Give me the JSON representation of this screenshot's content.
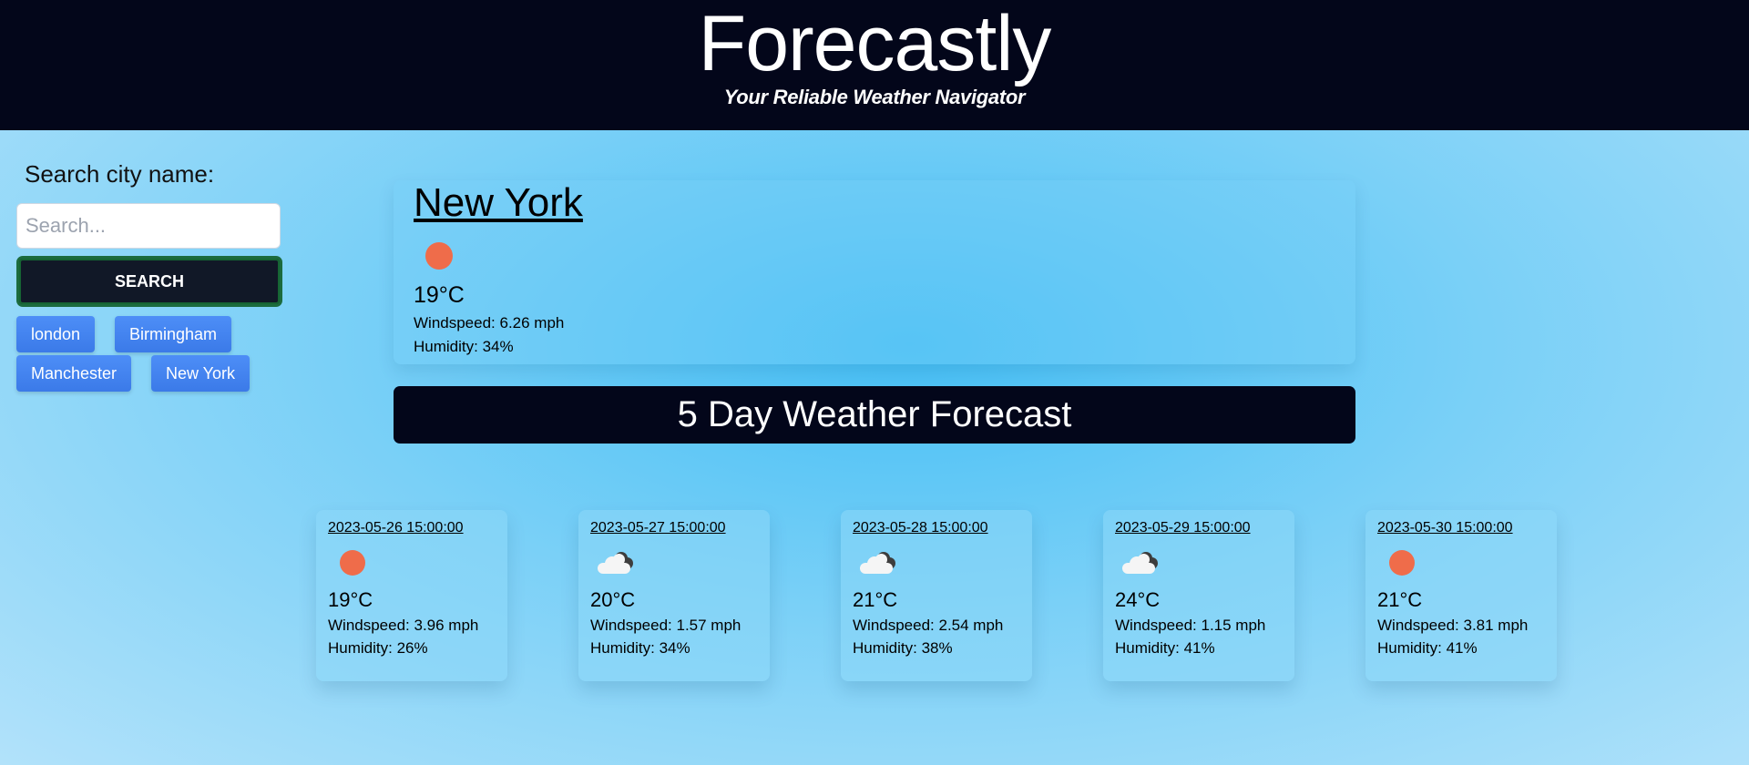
{
  "header": {
    "title": "Forecastly",
    "subtitle": "Your Reliable Weather Navigator"
  },
  "sidebar": {
    "label": "Search city name:",
    "placeholder": "Search...",
    "button": "SEARCH",
    "history": [
      "london",
      "Birmingham",
      "Manchester",
      "New York"
    ]
  },
  "current": {
    "city": "New York",
    "icon": "sun-icon",
    "temp": "19°C",
    "wind": "Windspeed: 6.26 mph",
    "humidity": "Humidity: 34%"
  },
  "forecast_title": "5 Day Weather Forecast",
  "forecast": [
    {
      "date": "2023-05-26 15:00:00",
      "icon": "sun-icon",
      "temp": "19°C",
      "wind": "Windspeed: 3.96 mph",
      "humidity": "Humidity: 26%"
    },
    {
      "date": "2023-05-27 15:00:00",
      "icon": "cloud-icon",
      "temp": "20°C",
      "wind": "Windspeed: 1.57 mph",
      "humidity": "Humidity: 34%"
    },
    {
      "date": "2023-05-28 15:00:00",
      "icon": "cloud-icon",
      "temp": "21°C",
      "wind": "Windspeed: 2.54 mph",
      "humidity": "Humidity: 38%"
    },
    {
      "date": "2023-05-29 15:00:00",
      "icon": "cloud-icon",
      "temp": "24°C",
      "wind": "Windspeed: 1.15 mph",
      "humidity": "Humidity: 41%"
    },
    {
      "date": "2023-05-30 15:00:00",
      "icon": "sun-icon",
      "temp": "21°C",
      "wind": "Windspeed: 3.81 mph",
      "humidity": "Humidity: 41%"
    }
  ],
  "colors": {
    "header_bg": "#03061a",
    "button_blue": "#3b7ae8",
    "sun": "#ef6c4a",
    "search_border": "#166534"
  }
}
